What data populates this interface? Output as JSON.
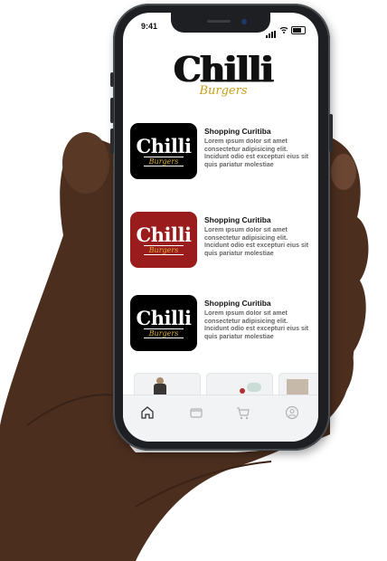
{
  "status_bar": {
    "time": "9:41"
  },
  "header": {
    "logo_title": "Chilli",
    "logo_subtitle": "Burgers"
  },
  "stores": [
    {
      "title": "Shopping Curitiba",
      "description": "Lorem ipsum dolor sit amet consectetur adipisicing elit. Incidunt odio est excepturi eius sit quis pariatur molestiae",
      "thumb_title": "Chilli",
      "thumb_subtitle": "Burgers",
      "thumb_color": "#000000"
    },
    {
      "title": "Shopping Curitiba",
      "description": "Lorem ipsum dolor sit amet consectetur adipisicing elit. Incidunt odio est excepturi eius sit quis pariatur molestiae",
      "thumb_title": "Chilli",
      "thumb_subtitle": "Burgers",
      "thumb_color": "#9b1c1c"
    },
    {
      "title": "Shopping Curitiba",
      "description": "Lorem ipsum dolor sit amet consectetur adipisicing elit. Incidunt odio est excepturi eius sit quis pariatur molestiae",
      "thumb_title": "Chilli",
      "thumb_subtitle": "Burgers",
      "thumb_color": "#000000"
    }
  ],
  "tabbar": {
    "items": [
      {
        "icon": "home-icon",
        "active": true
      },
      {
        "icon": "wallet-icon",
        "active": false
      },
      {
        "icon": "cart-icon",
        "active": false
      },
      {
        "icon": "profile-icon",
        "active": false
      }
    ]
  },
  "colors": {
    "brand_gold": "#c8a018",
    "brand_red": "#9b1c1c",
    "text_muted": "#666666"
  }
}
